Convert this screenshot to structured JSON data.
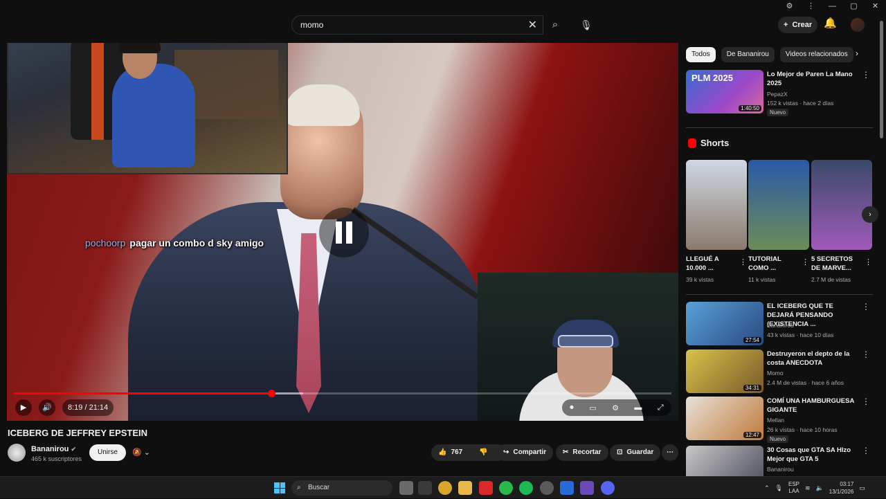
{
  "search": {
    "value": "momo"
  },
  "header": {
    "create_label": "Crear"
  },
  "video": {
    "chat_user": "pochoorp",
    "chat_text": "pagar un combo d sky amigo",
    "time": "8:19 / 21:14",
    "progress": 0.392,
    "buffer": 0.44
  },
  "meta": {
    "title": "ICEBERG DE JEFFREY EPSTEIN",
    "channel": "Bananirou",
    "subs": "465 k suscriptores",
    "join": "Unirse",
    "likes": "767",
    "share": "Compartir",
    "clip": "Recortar",
    "save": "Guardar"
  },
  "chips": [
    "Todos",
    "De Bananirou",
    "Videos relacionados"
  ],
  "recs_top": [
    {
      "title": "Lo Mejor de Paren La Mano 2025",
      "channel": "PepazX",
      "meta": "152 k vistas · hace 2 días",
      "badge": "Nuevo",
      "duration": "1:40:50",
      "thumb_text": "PLM 2025"
    }
  ],
  "shorts": {
    "title": "Shorts",
    "items": [
      {
        "title": "LLEGUÉ A 10.000 ...",
        "views": "39 k vistas"
      },
      {
        "title": "TUTORIAL COMO ...",
        "views": "11 k vistas"
      },
      {
        "title": "5 SECRETOS DE MARVE...",
        "views": "2.7 M de vistas"
      }
    ]
  },
  "recs": [
    {
      "title": "EL ICEBERG QUE TE DEJARÁ PENSANDO (EXISTENCIA ...",
      "channel": "Bananirou",
      "meta": "43 k vistas · hace 10 días",
      "badge": "",
      "duration": "27:54"
    },
    {
      "title": "Destruyeron el depto de la costa ANECDOTA",
      "channel": "Momo",
      "meta": "2.4 M de vistas · hace 6 años",
      "badge": "",
      "duration": "34:31"
    },
    {
      "title": "COMÍ UNA HAMBURGUESA GIGANTE",
      "channel": "Mellan",
      "meta": "26 k vistas · hace 10 horas",
      "badge": "Nuevo",
      "duration": "12:47"
    },
    {
      "title": "30 Cosas que GTA SA HIzo Mejor que GTA 5",
      "channel": "Bananirou",
      "meta": "",
      "badge": "",
      "duration": ""
    }
  ],
  "taskbar": {
    "search": "Buscar",
    "lang1": "ESP",
    "lang2": "LAA",
    "time": "03:17",
    "date": "13/1/2026"
  }
}
